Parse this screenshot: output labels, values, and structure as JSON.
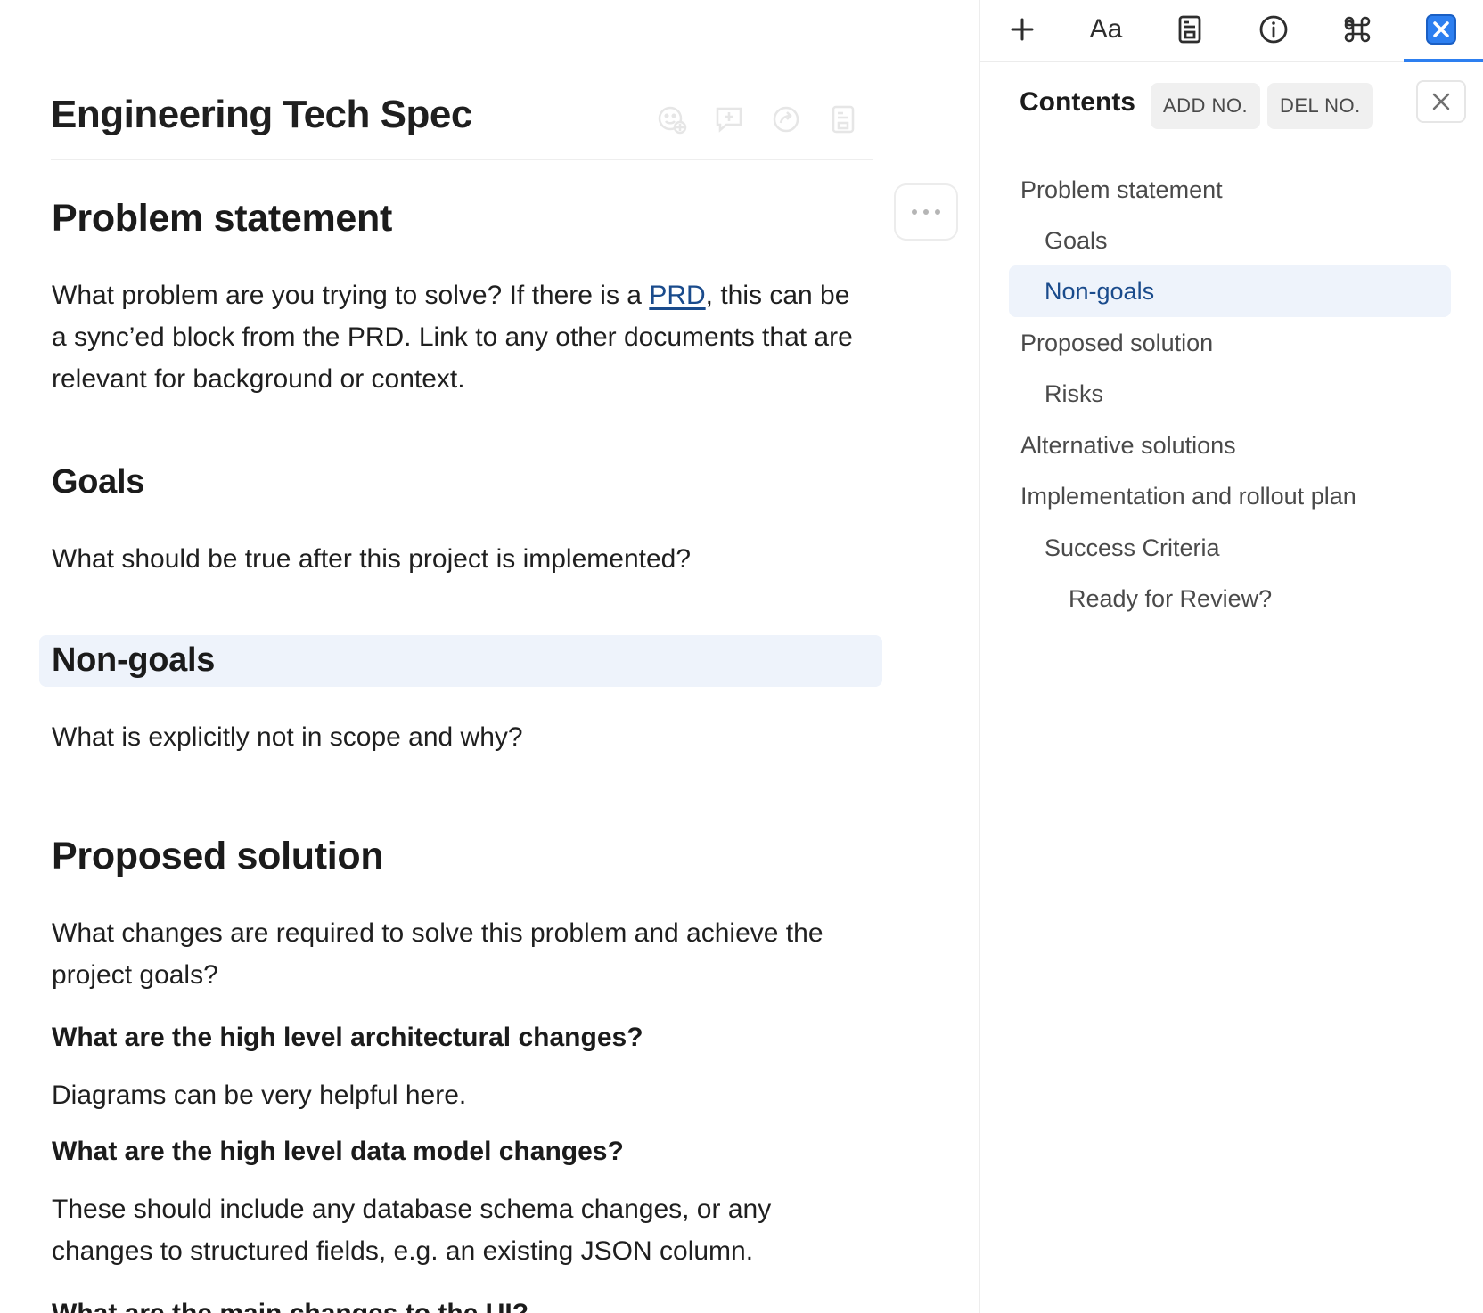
{
  "document": {
    "title": "Engineering Tech Spec",
    "title_tools": [
      "add-emoji-icon",
      "add-comment-icon",
      "share-icon",
      "template-icon"
    ],
    "more_menu_icon": "ellipsis-icon",
    "sections": {
      "problem_statement": {
        "heading": "Problem statement",
        "body_before_link": "What problem are you trying to solve? If there is a ",
        "link_text": "PRD",
        "body_after_link": ", this can be a sync’ed block from the PRD. Link to any other documents that are relevant for background or context."
      },
      "goals": {
        "heading": "Goals",
        "body": "What should be true after this project is implemented?"
      },
      "non_goals": {
        "heading": "Non-goals",
        "body": "What is explicitly not in scope and why?"
      },
      "proposed_solution": {
        "heading": "Proposed solution",
        "body": "What changes are required to solve this problem and achieve the project goals?",
        "q1": "What are the high level architectural changes?",
        "a1": "Diagrams can be very helpful here.",
        "q2": "What are the high level data model changes?",
        "a2": "These should include any database schema changes, or any changes to structured fields, e.g. an existing JSON column.",
        "q3": "What are the main changes to the UI?"
      }
    }
  },
  "panel": {
    "tabs": [
      {
        "icon": "plus-icon"
      },
      {
        "label": "Aa",
        "icon": "typography-icon"
      },
      {
        "icon": "template-icon"
      },
      {
        "icon": "info-icon"
      },
      {
        "icon": "command-icon"
      },
      {
        "icon": "close-box-icon",
        "active": true
      }
    ],
    "title": "Contents",
    "add_numbers_label": "ADD NO.",
    "delete_numbers_label": "DEL NO.",
    "close_icon": "close-icon",
    "toc": [
      {
        "label": "Problem statement",
        "level": 1
      },
      {
        "label": "Goals",
        "level": 2
      },
      {
        "label": "Non-goals",
        "level": 2,
        "active": true
      },
      {
        "label": "Proposed solution",
        "level": 1
      },
      {
        "label": "Risks",
        "level": 2
      },
      {
        "label": "Alternative solutions",
        "level": 1
      },
      {
        "label": "Implementation and rollout plan",
        "level": 1
      },
      {
        "label": "Success Criteria",
        "level": 2
      },
      {
        "label": "Ready for Review?",
        "level": 3
      }
    ]
  },
  "colors": {
    "accent": "#2d7ff0",
    "link": "#1a4b8c",
    "highlight": "#eef3fb"
  }
}
